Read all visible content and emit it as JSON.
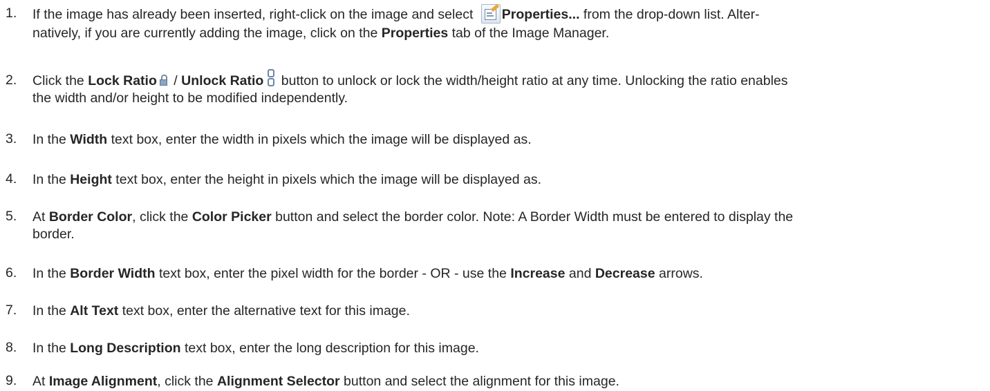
{
  "steps": [
    {
      "number": "1.",
      "line1_pre": "If the image has already been inserted, right-click on the image and select ",
      "bold_properties": "Properties...",
      "line1_post": " from the drop-down list. Alter-",
      "line2_pre": "natively, if you are currently adding the image, click on the ",
      "bold_properties_tab": "Properties",
      "line2_post": " tab of the Image Manager.",
      "icon": "properties-icon"
    },
    {
      "number": "2.",
      "pre": "Click the ",
      "bold_lock": "Lock Ratio",
      "sep": " / ",
      "bold_unlock": "Unlock Ratio",
      "post": " button to unlock or lock the width/height ratio at any time. Unlocking the ratio enables",
      "line2": "the width and/or height to be modified independently.",
      "icons": [
        "lock-ratio-icon",
        "unlock-ratio-icon"
      ]
    },
    {
      "number": "3.",
      "pre": "In the ",
      "bold": "Width",
      "post": " text box, enter the width in pixels which the image will be displayed as."
    },
    {
      "number": "4.",
      "pre": "In the ",
      "bold": "Height",
      "post": " text box, enter the height in pixels which the image will be displayed as."
    },
    {
      "number": "5.",
      "pre": "At ",
      "bold1": "Border Color",
      "mid": ", click the ",
      "bold2": "Color Picker",
      "post": " button and select the border color. Note: A Border Width must be entered to display the",
      "line2": "border."
    },
    {
      "number": "6.",
      "pre": "In the ",
      "bold1": "Border Width",
      "mid": " text box, enter the pixel width for the border - OR - use the ",
      "bold2": "Increase",
      "and": " and ",
      "bold3": "Decrease",
      "post": " arrows."
    },
    {
      "number": "7.",
      "pre": "In the ",
      "bold": "Alt Text",
      "post": " text box, enter the alternative text for this image."
    },
    {
      "number": "8.",
      "pre": "In the ",
      "bold": "Long Description",
      "post": " text box, enter the long description for this image."
    },
    {
      "number": "9.",
      "pre": "At ",
      "bold1": "Image Alignment",
      "mid": ", click the ",
      "bold2": "Alignment Selector",
      "post": " button and select the alignment for this image."
    }
  ]
}
